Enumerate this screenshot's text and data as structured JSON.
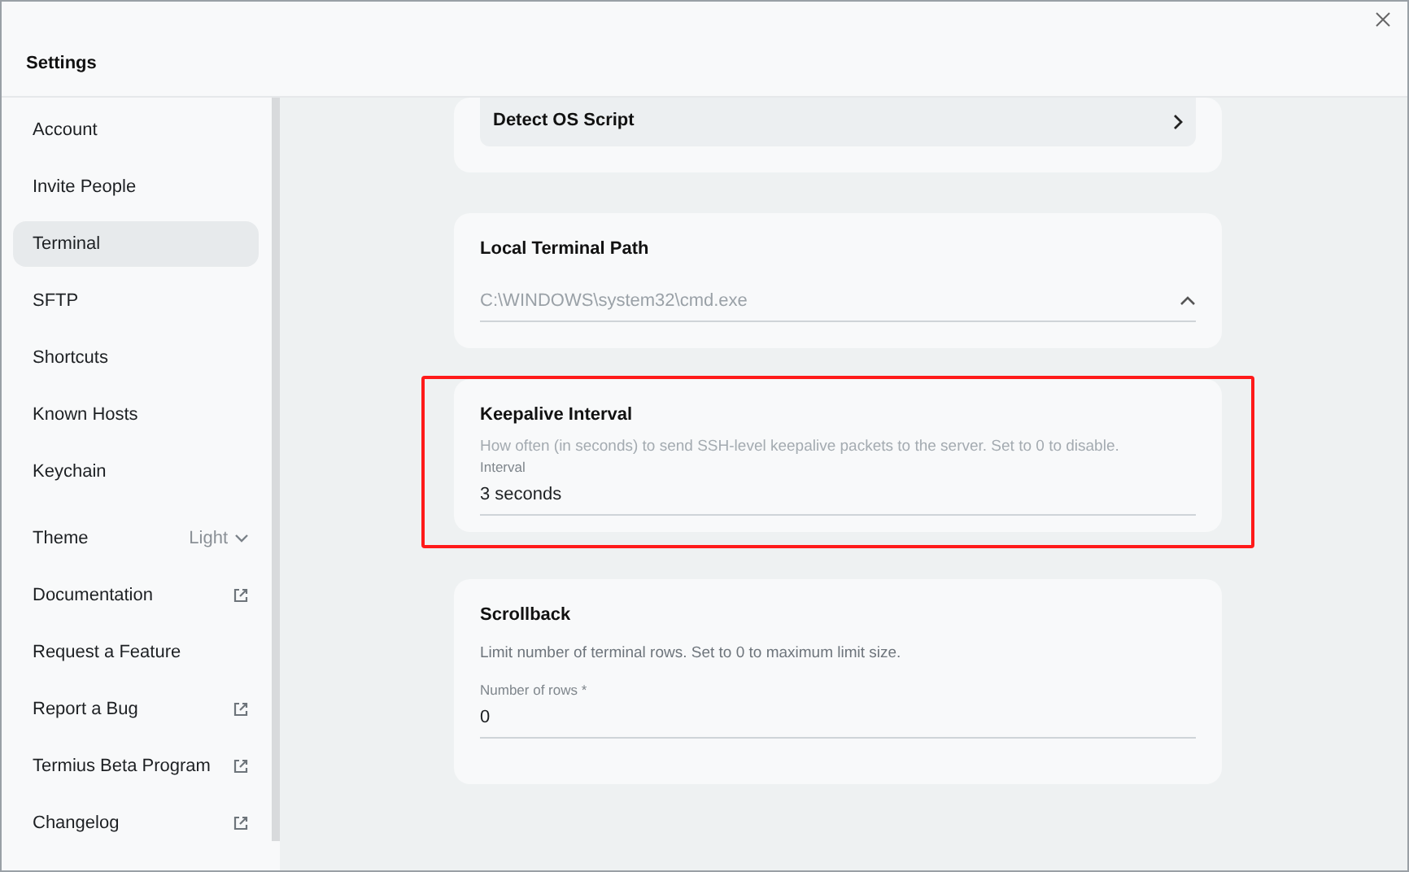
{
  "window": {
    "title": "Settings"
  },
  "sidebar": {
    "items": [
      {
        "label": "Account",
        "kind": "nav",
        "selected": false
      },
      {
        "label": "Invite People",
        "kind": "nav",
        "selected": false
      },
      {
        "label": "Terminal",
        "kind": "nav",
        "selected": true
      },
      {
        "label": "SFTP",
        "kind": "nav",
        "selected": false
      },
      {
        "label": "Shortcuts",
        "kind": "nav",
        "selected": false
      },
      {
        "label": "Known Hosts",
        "kind": "nav",
        "selected": false
      },
      {
        "label": "Keychain",
        "kind": "nav",
        "selected": false
      },
      {
        "label": "Theme",
        "kind": "select",
        "value": "Light",
        "selected": false
      },
      {
        "label": "Documentation",
        "kind": "external",
        "selected": false
      },
      {
        "label": "Request a Feature",
        "kind": "nav",
        "selected": false
      },
      {
        "label": "Report a Bug",
        "kind": "external",
        "selected": false
      },
      {
        "label": "Termius Beta Program",
        "kind": "external",
        "selected": false
      },
      {
        "label": "Changelog",
        "kind": "external",
        "selected": false
      }
    ]
  },
  "cards": [
    {
      "kind": "link",
      "title": "Detect OS Script"
    },
    {
      "kind": "select",
      "title": "Local Terminal Path",
      "value": "C:\\WINDOWS\\system32\\cmd.exe"
    },
    {
      "kind": "input",
      "title": "Keepalive Interval",
      "description": "How often (in seconds) to send SSH-level keepalive packets to the server. Set to 0 to disable.",
      "field_label": "Interval",
      "value": "3 seconds",
      "highlighted": true
    },
    {
      "kind": "input",
      "title": "Scrollback",
      "description": "Limit number of terminal rows. Set to 0 to maximum limit size.",
      "field_label": "Number of rows *",
      "value": "0",
      "highlighted": false
    }
  ]
}
